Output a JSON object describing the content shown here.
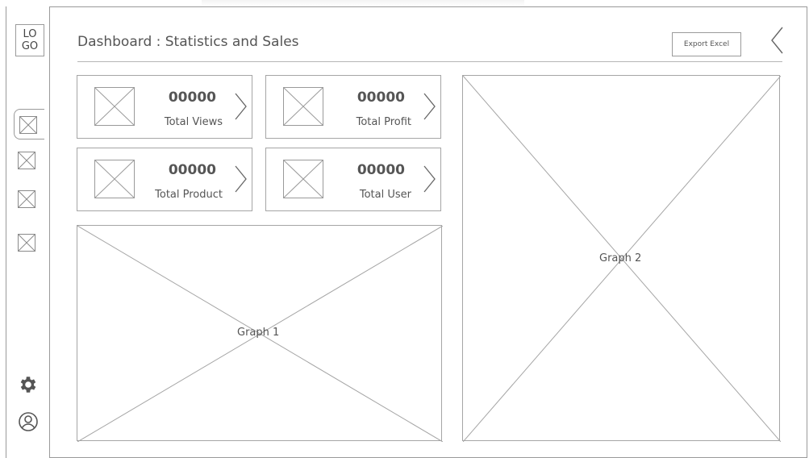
{
  "sidebar": {
    "logo_text": "LO\nGO",
    "items": [
      {
        "icon": "image-placeholder-icon",
        "active": true
      },
      {
        "icon": "image-placeholder-icon",
        "active": false
      },
      {
        "icon": "image-placeholder-icon",
        "active": false
      },
      {
        "icon": "image-placeholder-icon",
        "active": false
      }
    ],
    "settings_icon": "gear-icon",
    "profile_icon": "user-icon"
  },
  "header": {
    "title": "Dashboard : Statistics and Sales",
    "export_label": "Export Excel",
    "back_icon": "chevron-left-icon"
  },
  "cards": [
    {
      "value": "00000",
      "label": "Total Views"
    },
    {
      "value": "00000",
      "label": "Total Profit"
    },
    {
      "value": "00000",
      "label": "Total Product"
    },
    {
      "value": "00000",
      "label": "Total User"
    }
  ],
  "graphs": {
    "graph1_label": "Graph 1",
    "graph2_label": "Graph 2"
  },
  "colors": {
    "stroke": "#9a9a9a",
    "text": "#555555"
  }
}
